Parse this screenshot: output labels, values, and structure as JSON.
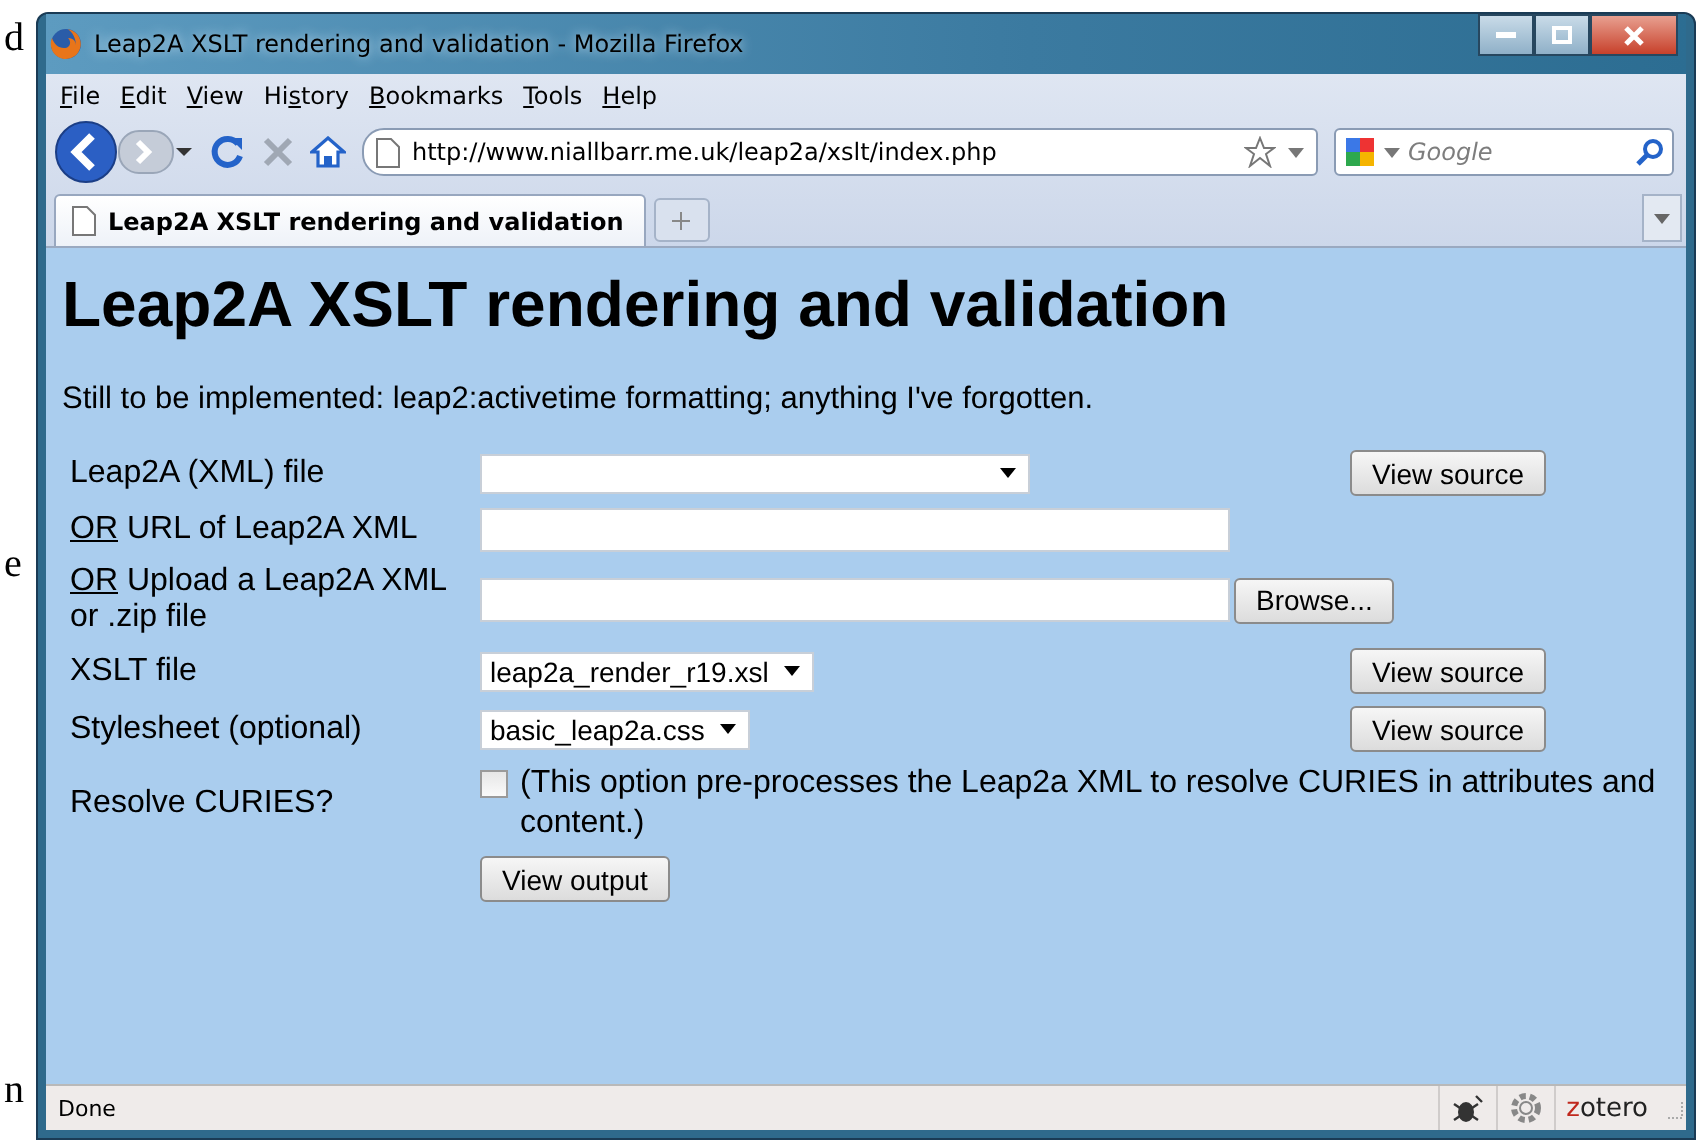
{
  "background_text": [
    "d",
    "e",
    "n"
  ],
  "window": {
    "title": "Leap2A XSLT rendering and validation - Mozilla Firefox"
  },
  "menu": [
    {
      "key": "F",
      "rest": "ile"
    },
    {
      "key": "E",
      "rest": "dit"
    },
    {
      "key": "V",
      "rest": "iew"
    },
    {
      "before": "Hi",
      "key": "s",
      "rest": "tory"
    },
    {
      "key": "B",
      "rest": "ookmarks"
    },
    {
      "key": "T",
      "rest": "ools"
    },
    {
      "key": "H",
      "rest": "elp"
    }
  ],
  "nav": {
    "url": "http://www.niallbarr.me.uk/leap2a/xslt/index.php",
    "search_placeholder": "Google"
  },
  "tabs": [
    {
      "label": "Leap2A XSLT rendering and validation",
      "selected": true
    }
  ],
  "page": {
    "heading": "Leap2A XSLT rendering and validation",
    "note": "Still to be implemented: leap2:activetime formatting; anything I've forgotten.",
    "fields": [
      {
        "kind": "select",
        "label": "Leap2A (XML) file",
        "button": "View source"
      },
      {
        "kind": "text",
        "prefix": "OR",
        "label": "URL of Leap2A XML"
      },
      {
        "kind": "file",
        "prefix": "OR",
        "label": "Upload a Leap2A XML or .zip file",
        "button": "Browse..."
      },
      {
        "kind": "select",
        "label": "XSLT file",
        "value": "leap2a_render_r19.xsl",
        "button": "View source"
      },
      {
        "kind": "select",
        "label": "Stylesheet (optional)",
        "value": "basic_leap2a.css",
        "button": "View source"
      },
      {
        "kind": "checkbox",
        "label": "Resolve CURIES?",
        "checked": false,
        "note": "(This option pre-processes the Leap2a XML to resolve CURIES in attributes and content.)"
      }
    ],
    "submit": "View output"
  },
  "status_bar": {
    "text": "Done",
    "logo": "zotero"
  }
}
